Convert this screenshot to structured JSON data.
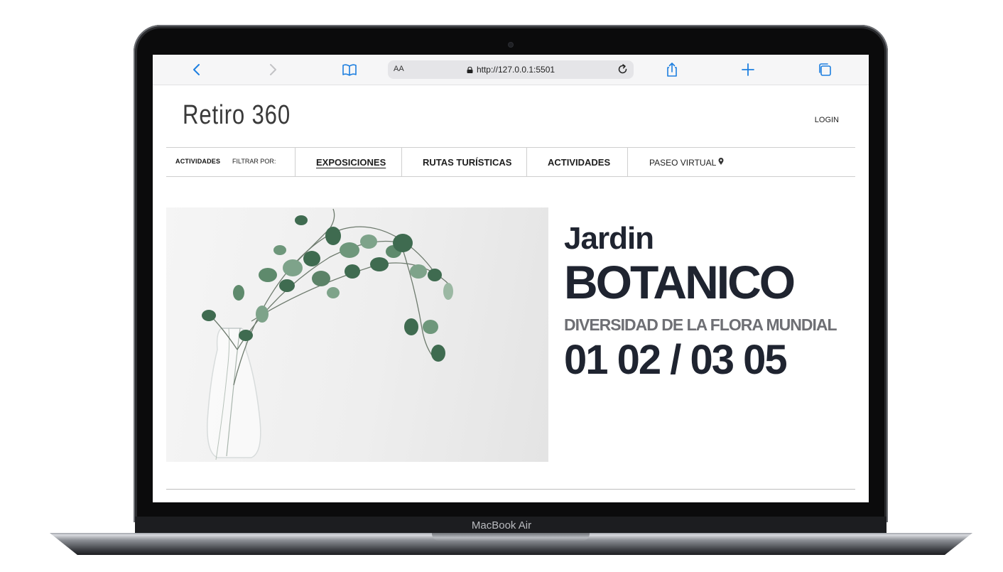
{
  "device": {
    "model_label": "MacBook Air"
  },
  "browser": {
    "reader_toggle": "AA",
    "url": "http://127.0.0.1:5501",
    "icons": [
      "back-icon",
      "forward-icon",
      "bookmarks-icon",
      "lock-icon",
      "reload-icon",
      "share-icon",
      "new-tab-icon",
      "tabs-icon"
    ]
  },
  "site": {
    "logo": "Retiro 360",
    "login": "LOGIN",
    "nav": {
      "section_label": "ACTIVIDADES",
      "filter_label": "FILTRAR POR:",
      "items": [
        {
          "label": "EXPOSICIONES",
          "active": true
        },
        {
          "label": "RUTAS TURÍSTICAS",
          "active": false
        },
        {
          "label": "ACTIVIDADES",
          "active": false
        }
      ],
      "virtual_tour": "PASEO VIRTUAL"
    }
  },
  "hero": {
    "title_small": "Jardin",
    "title_big": "BOTANICO",
    "subtitle": "DIVERSIDAD DE LA FLORA MUNDIAL",
    "dates": "01 02 / 03 05"
  },
  "colors": {
    "accent": "#1d7fe0",
    "title": "#1f2430",
    "subtitle": "#6e6f74"
  }
}
